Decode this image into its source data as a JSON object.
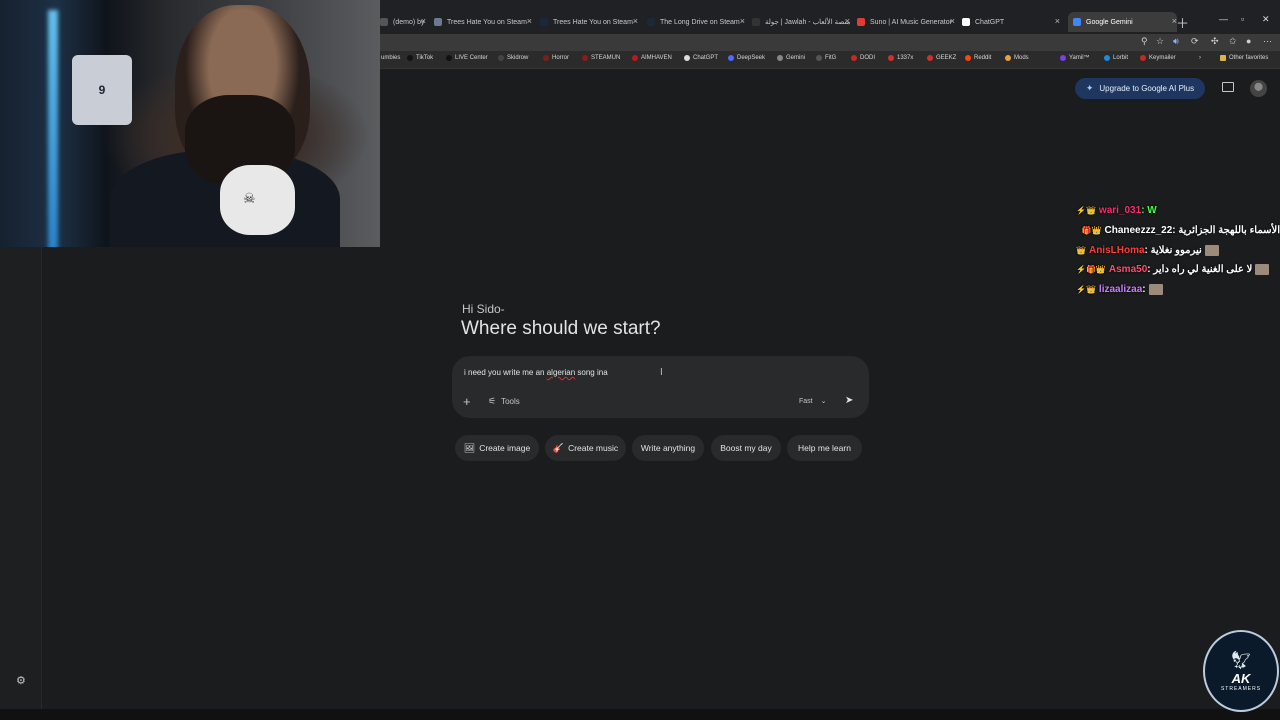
{
  "browser": {
    "tabs": [
      {
        "title": "(demo) by ty...",
        "color": "#555"
      },
      {
        "title": "Trees Hate You on Steam",
        "color": "#6b7a8f"
      },
      {
        "title": "Trees Hate You on Steam",
        "color": "#1b2838"
      },
      {
        "title": "The Long Drive on Steam",
        "color": "#1b2838"
      },
      {
        "title": "جولة | Jawlah - منصة الألعاب",
        "color": "#333"
      },
      {
        "title": "Suno | AI Music Generator",
        "color": "#e53935"
      },
      {
        "title": "ChatGPT",
        "color": "#ffffff"
      },
      {
        "title": "Google Gemini",
        "color": "#4285f4"
      }
    ],
    "bookmarks": [
      {
        "label": "umbies",
        "color": "#666"
      },
      {
        "label": "TikTok",
        "color": "#111"
      },
      {
        "label": "LIVE Center",
        "color": "#111"
      },
      {
        "label": "Skidrow",
        "color": "#444"
      },
      {
        "label": "Horror",
        "color": "#7a1f1f"
      },
      {
        "label": "STEAMUN",
        "color": "#8b1c1c"
      },
      {
        "label": "AIMHAVEN",
        "color": "#b71c1c"
      },
      {
        "label": "ChatGPT",
        "color": "#ddd"
      },
      {
        "label": "DeepSeek",
        "color": "#4d6bfe"
      },
      {
        "label": "Gemini",
        "color": "#888"
      },
      {
        "label": "FitG",
        "color": "#555"
      },
      {
        "label": "DODI",
        "color": "#c62828"
      },
      {
        "label": "1337x",
        "color": "#d32f2f"
      },
      {
        "label": "GEEKZ",
        "color": "#d32f2f"
      },
      {
        "label": "Reddit",
        "color": "#ff4500"
      },
      {
        "label": "Mods",
        "color": "#e6a23c"
      },
      {
        "label": "Yamil™",
        "color": "#7b3fe4"
      },
      {
        "label": "Lorbit",
        "color": "#1e88e5"
      },
      {
        "label": "Keymailer",
        "color": "#c62828"
      }
    ],
    "other_favorites": "Other favorites"
  },
  "gemini": {
    "upgrade_label": "Upgrade to Google AI Plus",
    "greeting_small": "Hi Sido-",
    "greeting_big": "Where should we start?",
    "prompt_before": "i need you write me an ",
    "prompt_typo": "algerian",
    "prompt_after": " song ina",
    "tools_label": "Tools",
    "model_label": "Fast",
    "chips": [
      {
        "icon": "🖼",
        "label": "Create image"
      },
      {
        "icon": "🎸",
        "label": "Create music"
      },
      {
        "icon": "",
        "label": "Write anything"
      },
      {
        "icon": "",
        "label": "Boost my day"
      },
      {
        "icon": "",
        "label": "Help me learn"
      }
    ]
  },
  "stream": {
    "chat": [
      {
        "badges": "⚡👑",
        "user": "wari_031",
        "user_color": "#ff2a6d",
        "msg": " : W",
        "msg_color": "#44ff44"
      },
      {
        "badges": "🎁👑",
        "user": "Chaneezzz_22",
        "user_color": "#ffffff",
        "msg": " : الأسماء باللهجة الجزائرية",
        "msg_color": "#ffffff"
      },
      {
        "badges": "👑",
        "user": "AnisLHoma",
        "user_color": "#ff3b3b",
        "msg": " : نيرموو نغلاية",
        "msg_color": "#ffffff"
      },
      {
        "badges": "⚡🎁👑",
        "user": "Asma50",
        "user_color": "#ff4d6d",
        "msg": " : لا على الغنية لي راه داير",
        "msg_color": "#ffffff"
      },
      {
        "badges": "⚡👑",
        "user": "lizaalizaa",
        "user_color": "#c77dff",
        "msg": " :",
        "msg_color": "#ffffff"
      }
    ],
    "logo_text": "AK",
    "logo_sub": "STREAMERS",
    "jersey_number": "9"
  }
}
